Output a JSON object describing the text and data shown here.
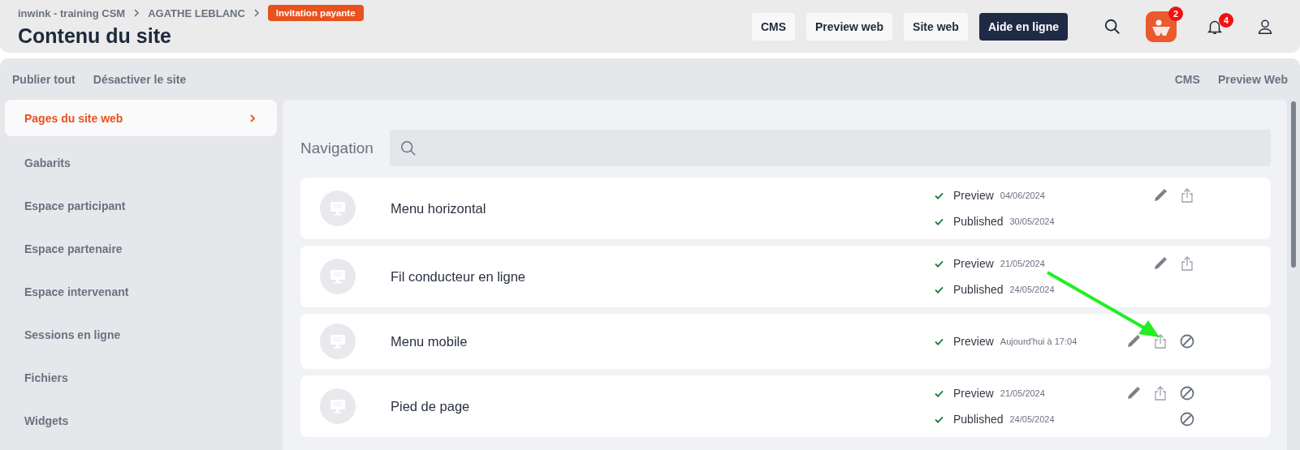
{
  "breadcrumb": [
    "inwink - training CSM",
    "AGATHE LEBLANC"
  ],
  "badge": "Invitation payante",
  "title": "Contenu du site",
  "header_buttons": [
    {
      "label": "CMS",
      "kind": "light"
    },
    {
      "label": "Preview web",
      "kind": "light"
    },
    {
      "label": "Site web",
      "kind": "light"
    },
    {
      "label": "Aide en ligne",
      "kind": "dark"
    }
  ],
  "header_icons": [
    {
      "kind": "search"
    },
    {
      "kind": "app",
      "count": "2"
    },
    {
      "kind": "bell",
      "count": "4"
    },
    {
      "kind": "user"
    }
  ],
  "toolbar_left": [
    "Publier tout",
    "Désactiver le site"
  ],
  "toolbar_right": [
    "CMS",
    "Preview Web"
  ],
  "sidebar": {
    "items": [
      {
        "label": "Pages du site web",
        "selected": true
      },
      {
        "label": "Gabarits",
        "selected": false
      },
      {
        "label": "Espace participant",
        "selected": false
      },
      {
        "label": "Espace partenaire",
        "selected": false
      },
      {
        "label": "Espace intervenant",
        "selected": false
      },
      {
        "label": "Sessions en ligne",
        "selected": false
      },
      {
        "label": "Fichiers",
        "selected": false
      },
      {
        "label": "Widgets",
        "selected": false
      }
    ]
  },
  "section_title": "Navigation",
  "pages": [
    {
      "name": "Menu horizontal",
      "statuses": [
        {
          "label": "Preview",
          "date": "04/06/2024",
          "edit": true,
          "publish": true
        },
        {
          "label": "Published",
          "date": "30/05/2024"
        }
      ]
    },
    {
      "name": "Fil conducteur en ligne",
      "statuses": [
        {
          "label": "Preview",
          "date": "21/05/2024",
          "edit": true,
          "publish": true
        },
        {
          "label": "Published",
          "date": "24/05/2024"
        }
      ]
    },
    {
      "name": "Menu mobile",
      "statuses": [
        {
          "label": "Preview",
          "date": "Aujourd'hui à 17:04",
          "edit": true,
          "publish": true,
          "disable": true
        }
      ]
    },
    {
      "name": "Pied de page",
      "statuses": [
        {
          "label": "Preview",
          "date": "21/05/2024",
          "edit": true,
          "publish": true,
          "disable": true
        },
        {
          "label": "Published",
          "date": "24/05/2024",
          "disable": true
        }
      ]
    }
  ],
  "annotations": [
    {
      "kind": "arrow"
    }
  ]
}
